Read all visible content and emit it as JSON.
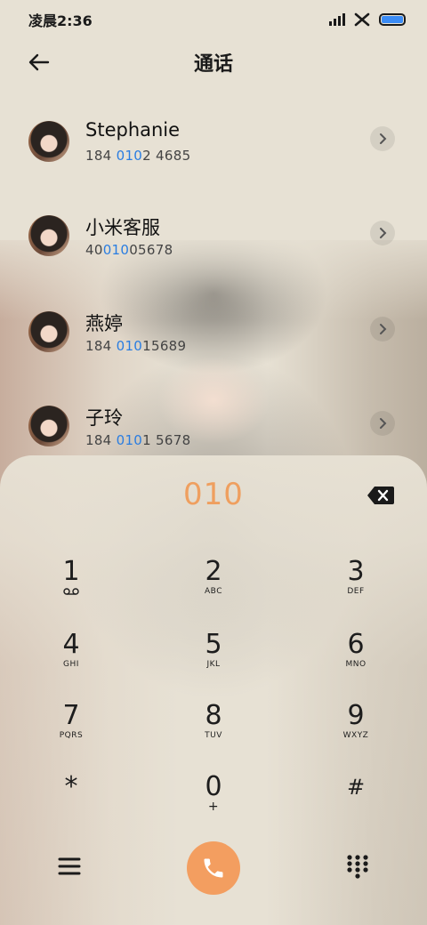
{
  "status_bar": {
    "time": "凌晨2:36"
  },
  "header": {
    "title": "通话"
  },
  "contacts": [
    {
      "name": "Stephanie",
      "number_pre": "184 ",
      "number_hl": "010",
      "number_post": "2 4685"
    },
    {
      "name": "小米客服",
      "number_pre": "40",
      "number_hl": "010",
      "number_post": "05678"
    },
    {
      "name": "燕婷",
      "number_pre": "184 ",
      "number_hl": "010",
      "number_post": "15689"
    },
    {
      "name": "子玲",
      "number_pre": "184 ",
      "number_hl": "010",
      "number_post": "1 5678"
    }
  ],
  "dialpad": {
    "input": "010",
    "keys": [
      {
        "digit": "1",
        "letters": ""
      },
      {
        "digit": "2",
        "letters": "ABC"
      },
      {
        "digit": "3",
        "letters": "DEF"
      },
      {
        "digit": "4",
        "letters": "GHI"
      },
      {
        "digit": "5",
        "letters": "JKL"
      },
      {
        "digit": "6",
        "letters": "MNO"
      },
      {
        "digit": "7",
        "letters": "PQRS"
      },
      {
        "digit": "8",
        "letters": "TUV"
      },
      {
        "digit": "9",
        "letters": "WXYZ"
      },
      {
        "digit": "*",
        "letters": ""
      },
      {
        "digit": "0",
        "letters": "+"
      },
      {
        "digit": "#",
        "letters": ""
      }
    ]
  },
  "colors": {
    "accent": "#f39e60",
    "highlight": "#2a7de1",
    "background": "#e7e1d4"
  },
  "icons": {
    "back": "arrow-left-icon",
    "chevron": "chevron-right-icon",
    "backspace": "backspace-icon",
    "voicemail": "voicemail-icon",
    "menu": "menu-icon",
    "call": "phone-icon",
    "grid": "dialpad-grid-icon"
  }
}
